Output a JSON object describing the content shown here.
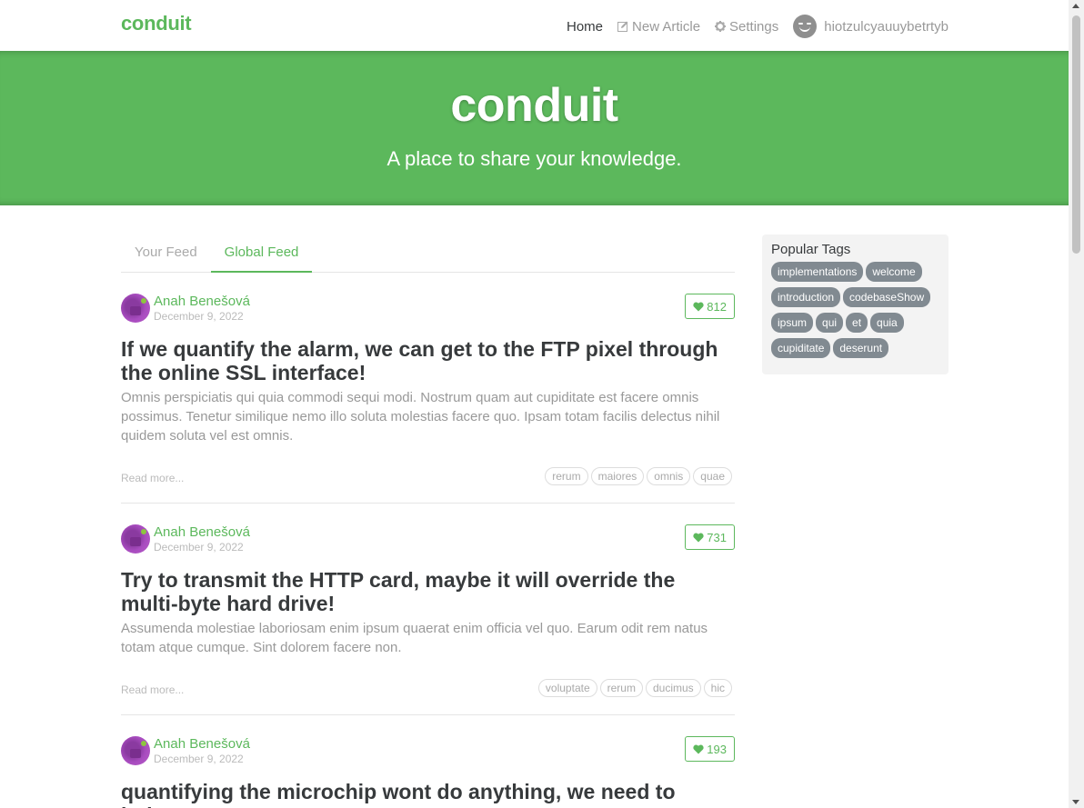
{
  "navbar": {
    "brand": "conduit",
    "items": [
      {
        "label": "Home",
        "icon": ""
      },
      {
        "label": "New Article",
        "icon": "edit-icon"
      },
      {
        "label": "Settings",
        "icon": "gear-icon"
      },
      {
        "label": "hiotzulcyauuybetrtyb",
        "icon": "user-avatar"
      }
    ]
  },
  "banner": {
    "title": "conduit",
    "subtitle": "A place to share your knowledge."
  },
  "feed": {
    "tabs": [
      "Your Feed",
      "Global Feed"
    ],
    "active_tab": "Global Feed"
  },
  "articles": [
    {
      "author": "Anah Benešová",
      "date": "December 9, 2022",
      "likes": "812",
      "title": "If we quantify the alarm, we can get to the FTP pixel through the online SSL interface!",
      "description": "Omnis perspiciatis qui quia commodi sequi modi. Nostrum quam aut cupiditate est facere omnis possimus. Tenetur similique nemo illo soluta molestias facere quo. Ipsam totam facilis delectus nihil quidem soluta vel est omnis.",
      "read_more": "Read more...",
      "tags": [
        "rerum",
        "maiores",
        "omnis",
        "quae"
      ]
    },
    {
      "author": "Anah Benešová",
      "date": "December 9, 2022",
      "likes": "731",
      "title": "Try to transmit the HTTP card, maybe it will override the multi-byte hard drive!",
      "description": "Assumenda molestiae laboriosam enim ipsum quaerat enim officia vel quo. Earum odit rem natus totam atque cumque. Sint dolorem facere non.",
      "read_more": "Read more...",
      "tags": [
        "voluptate",
        "rerum",
        "ducimus",
        "hic"
      ]
    },
    {
      "author": "Anah Benešová",
      "date": "December 9, 2022",
      "likes": "193",
      "title": "quantifying the microchip wont do anything, we need to index",
      "description": "",
      "read_more": "",
      "tags": []
    }
  ],
  "sidebar": {
    "title": "Popular Tags",
    "tags": [
      "implementations",
      "welcome",
      "introduction",
      "codebaseShow",
      "ipsum",
      "qui",
      "et",
      "quia",
      "cupiditate",
      "deserunt"
    ]
  },
  "colors": {
    "accent": "#5cb85c",
    "tag_bg": "#818a91"
  }
}
